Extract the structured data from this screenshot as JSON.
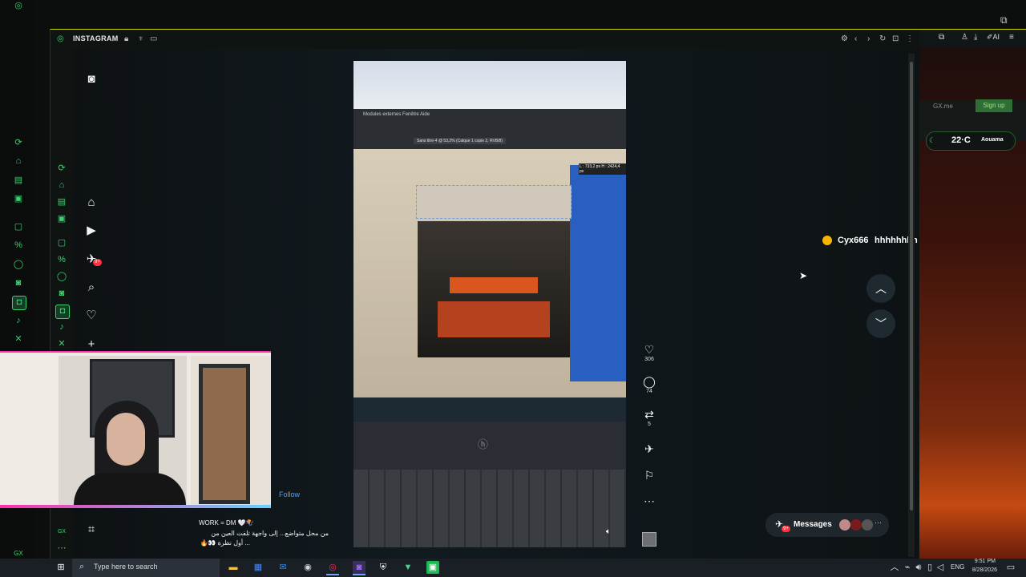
{
  "window": {
    "title": "INSTAGRAM"
  },
  "reel": {
    "caption_line1": "WORK = DM 🤍🪁",
    "caption_line2": "من محل متواضع... إلى واجهة تلفت العين من",
    "caption_line3": "... أول نظرة 👀🔥",
    "follow_label": "Follow",
    "likes": "306",
    "comments": "74",
    "reposts": "5",
    "comment_user": "Cyx666",
    "comment_text": "hhhhhhhh",
    "screen_menu": "Modules externes  Fenêtre  Aide",
    "screen_tab": "Sans titre-4 @ 53,2% (Calque 1 copie 2, RVB/8)",
    "screen_dim": "L : 733,2 px  H : 2424,4 px"
  },
  "messages": {
    "label": "Messages",
    "badge": "9+"
  },
  "nav": {
    "notifications_badge": "9+"
  },
  "right_panel": {
    "gx_label": "GX.me",
    "signup_label": "Sign up",
    "temperature": "22·C",
    "city": "Aouama"
  },
  "taskbar": {
    "search_placeholder": "Type here to search",
    "lang": "ENG",
    "time": "9:51 PM",
    "date": "8/28/2026"
  },
  "colors": {
    "accent": "#c9d400",
    "gx_green": "#3bd16f",
    "pink_border": "#ff2fa8",
    "link_blue": "#4aa3ff"
  }
}
